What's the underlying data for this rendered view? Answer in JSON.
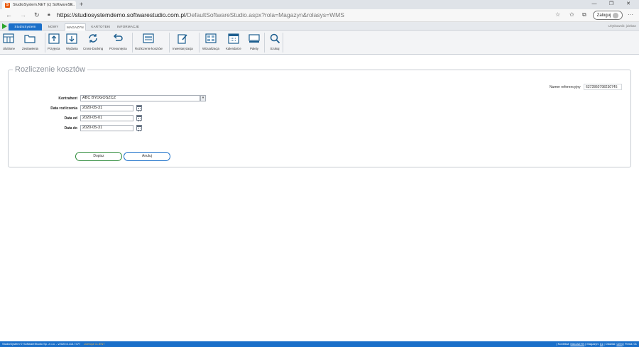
{
  "browser": {
    "tab_title": "StudioSystem.NET (c) SoftwareSt...",
    "tab_favicon": "S",
    "url_host": "https://studiosystemdemo.softwarestudio.com.pl",
    "url_path": "/DefaultSoftwareStudio.aspx?rola=Magazyn&rolasys=WMS",
    "login_label": "Zaloguj"
  },
  "app_tabs": {
    "brand": "StudioSystem",
    "nowy": "NOWY",
    "magazyn": "MAGAZYN",
    "kartoteki": "KARTOTEKI",
    "informacje": "INFORMACJE"
  },
  "user_label": "Użytkownik: jzieban",
  "ribbon": {
    "ulubione": "Ulubione",
    "zestawienia": "Zestawienia",
    "przyjecia": "Przyjęcia",
    "wydania": "Wydania",
    "cross_docking": "Cross-Docking",
    "przesuniecia": "Przesunięcia",
    "rozliczenie": "Rozliczenie kosztów",
    "inwentaryzacja": "Inwentaryzacja",
    "wizualizacja": "Wizualizacja",
    "kalendarze": "Kalendarze",
    "palety": "Palety",
    "szukaj": "Szukaj"
  },
  "form": {
    "title": "Rozliczenie kosztów",
    "ref_label": "Numer referencyjny",
    "ref_value": "637286079823074​5",
    "kontrahent_label": "Kontrahent",
    "kontrahent_value": "ABC BYDGOSZCZ",
    "data_rozl_label": "Data rozliczenia",
    "data_rozl_value": "2020-05-31",
    "data_od_label": "Data od",
    "data_od_value": "2020-05-01",
    "data_do_label": "Data do",
    "data_do_value": "2020-05-31",
    "save_label": "Dopisz",
    "cancel_label": "Anuluj"
  },
  "status": {
    "left": "StudioSystem © SoftwareStudio Sp. z o.o. - v2020.6.113.7477",
    "license": "Licencja CLIENT",
    "right_prefix": "| Kontekst: ",
    "context": "MAGAZYN",
    "magazyn_prefix": " | Magazyn: ",
    "magazyn": "01",
    "oddzial_prefix": " | Oddział: ",
    "oddzial": "CEN",
    "firma": " | Firma: 01"
  },
  "colors": {
    "brand": "#1a6fc9",
    "save_border": "#2e8b3a"
  }
}
